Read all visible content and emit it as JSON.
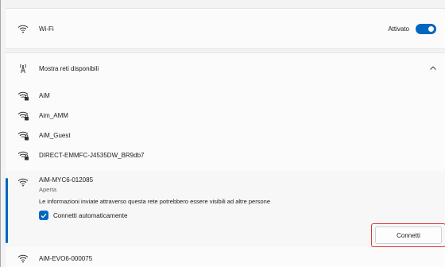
{
  "wifi": {
    "label": "Wi-Fi",
    "status": "Attivato",
    "enabled": true
  },
  "available": {
    "label": "Mostra reti disponibili",
    "expanded": true
  },
  "networks": [
    {
      "name": "AiM",
      "secured": true
    },
    {
      "name": "Aim_AMM",
      "secured": true
    },
    {
      "name": "AiM_Guest",
      "secured": true
    },
    {
      "name": "DIRECT-EMMFC-J4535DW_BR9db7",
      "secured": true
    }
  ],
  "selected": {
    "name": "AiM-MYC6-012085",
    "security": "Aperta",
    "warning": "Le informazioni inviate attraverso questa rete potrebbero essere visibili ad altre persone",
    "auto_connect_label": "Connetti automaticamente",
    "auto_connect_checked": true,
    "connect_label": "Connetti"
  },
  "next_network": {
    "name": "AiM-EVO6-000075"
  },
  "colors": {
    "accent": "#0067c0",
    "highlight": "#d93a3a"
  }
}
